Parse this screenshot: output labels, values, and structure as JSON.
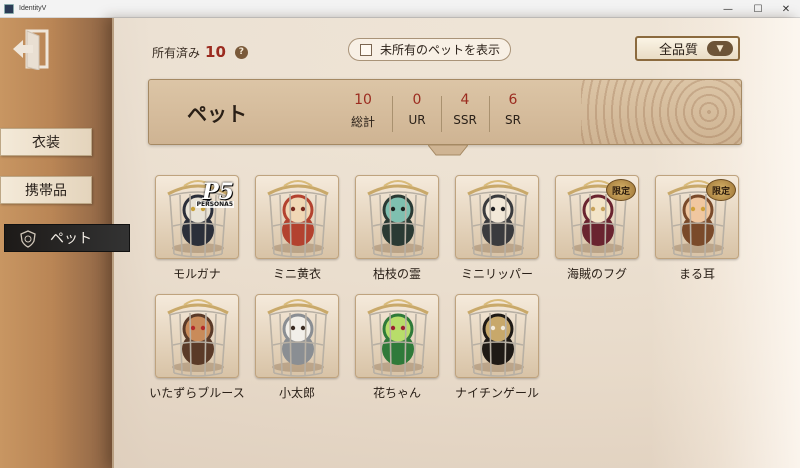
{
  "window": {
    "title": "IdentityV",
    "minimize": "—",
    "maximize": "☐",
    "close": "✕"
  },
  "nav": {
    "tabs": [
      {
        "label": "衣装",
        "active": false
      },
      {
        "label": "携帯品",
        "active": false
      },
      {
        "label": "ペット",
        "active": true
      }
    ]
  },
  "header": {
    "owned_label": "所有済み",
    "owned_count": "10",
    "help_icon": "?",
    "show_unowned_label": "未所有のペットを表示",
    "show_unowned_checked": false,
    "quality_filter": "全品質"
  },
  "summary": {
    "title": "ペット",
    "stats": [
      {
        "value": "10",
        "label": "総計"
      },
      {
        "value": "0",
        "label": "UR"
      },
      {
        "value": "4",
        "label": "SSR"
      },
      {
        "value": "6",
        "label": "SR"
      }
    ]
  },
  "pets": [
    {
      "name": "モルガナ",
      "badge": "P5",
      "badge_sub": "PERSONA5",
      "icon": "cat-mascot-icon"
    },
    {
      "name": "ミニ黄衣",
      "badge": "",
      "icon": "hooded-figure-icon"
    },
    {
      "name": "枯枝の霊",
      "badge": "",
      "icon": "tree-spirit-icon"
    },
    {
      "name": "ミニリッパー",
      "badge": "",
      "icon": "top-hat-figure-icon"
    },
    {
      "name": "海賊のフグ",
      "badge": "限定",
      "icon": "pufferfish-icon"
    },
    {
      "name": "まる耳",
      "badge": "限定",
      "icon": "round-ears-icon"
    },
    {
      "name": "いたずらブルース",
      "badge": "",
      "icon": "reindeer-icon"
    },
    {
      "name": "小太郎",
      "badge": "",
      "icon": "dog-icon"
    },
    {
      "name": "花ちゃん",
      "badge": "",
      "icon": "flower-plant-icon"
    },
    {
      "name": "ナイチンゲール",
      "badge": "",
      "icon": "bird-icon"
    }
  ],
  "colors": {
    "accent_red": "#9b2b1f",
    "panel": "#efe3d2",
    "active_tab": "#1d1a18"
  }
}
